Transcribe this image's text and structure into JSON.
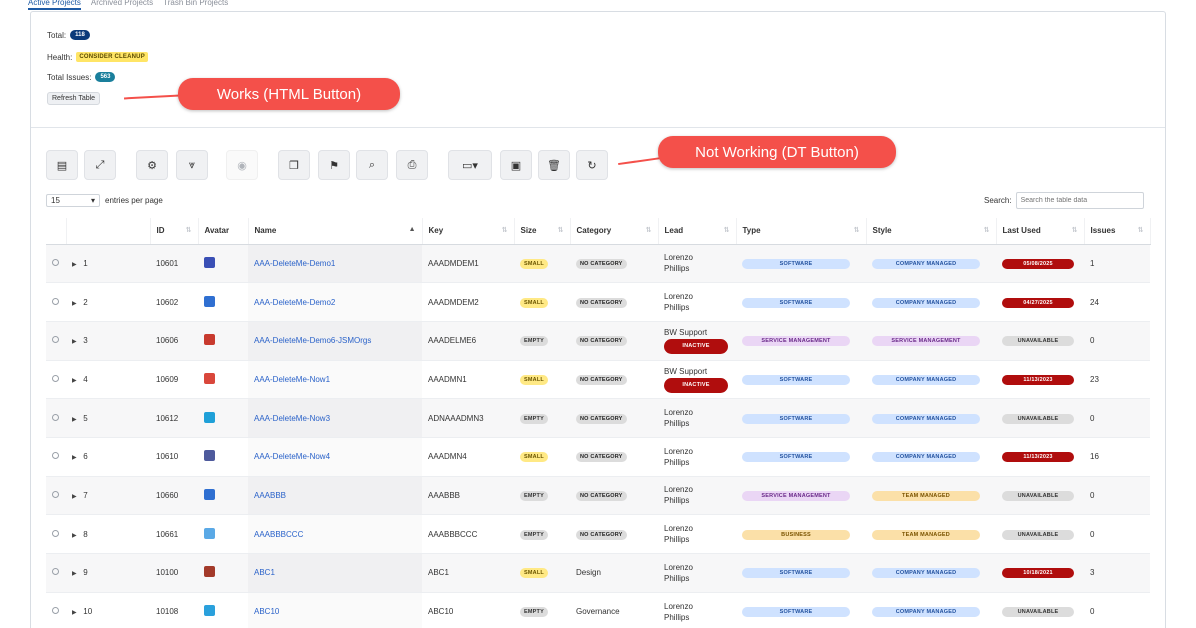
{
  "tabs": [
    "Active Projects",
    "Archived Projects",
    "Trash Bin Projects"
  ],
  "summary": {
    "total_label": "Total:",
    "total_value": "118",
    "health_label": "Health:",
    "health_value": "CONSIDER CLEANUP",
    "issues_label": "Total Issues:",
    "issues_value": "563",
    "refresh_label": "Refresh Table"
  },
  "callouts": {
    "works": "Works (HTML Button)",
    "not_working": "Not Working (DT Button)"
  },
  "toolbar": {
    "buttons": [
      "select-all-icon",
      "expand-icon",
      "settings-icon",
      "collapse-icon",
      "eye-icon",
      "copy-icon",
      "bookmark-icon",
      "search-doc-icon",
      "print-icon",
      "columns-icon",
      "save-icon",
      "trash-icon",
      "refresh-icon"
    ]
  },
  "entries": {
    "value": "15",
    "suffix": "entries per page"
  },
  "search": {
    "label": "Search:",
    "placeholder": "Search the table data"
  },
  "columns": [
    "",
    "",
    "ID",
    "Avatar",
    "Name",
    "Key",
    "Size",
    "Category",
    "Lead",
    "Type",
    "Style",
    "Last Used",
    "Issues"
  ],
  "rows": [
    {
      "num": "1",
      "id": "10601",
      "avatar_color": "#3a4fb5",
      "name": "AAA-DeleteMe-Demo1",
      "key": "AAADMDEM1",
      "size": "SMALL",
      "category": "NO CATEGORY",
      "lead": [
        "Lorenzo",
        "Phillips"
      ],
      "inactive": "",
      "type": "SOFTWARE",
      "style": "COMPANY MANAGED",
      "last_used": "05/08/2025",
      "issues": "1"
    },
    {
      "num": "2",
      "id": "10602",
      "avatar_color": "#2f6fd1",
      "name": "AAA-DeleteMe-Demo2",
      "key": "AAADMDEM2",
      "size": "SMALL",
      "category": "NO CATEGORY",
      "lead": [
        "Lorenzo",
        "Phillips"
      ],
      "inactive": "",
      "type": "SOFTWARE",
      "style": "COMPANY MANAGED",
      "last_used": "04/27/2025",
      "issues": "24"
    },
    {
      "num": "3",
      "id": "10606",
      "avatar_color": "#c83a2e",
      "name": "AAA-DeleteMe-Demo6-JSMOrgs",
      "key": "AAADELME6",
      "size": "EMPTY",
      "category": "NO CATEGORY",
      "lead": [
        "BW Support",
        ""
      ],
      "inactive": "INACTIVE",
      "type": "SERVICE MANAGEMENT",
      "style": "SERVICE MANAGEMENT",
      "last_used": "UNAVAILABLE",
      "issues": "0"
    },
    {
      "num": "4",
      "id": "10609",
      "avatar_color": "#d9473b",
      "name": "AAA-DeleteMe-Now1",
      "key": "AAADMN1",
      "size": "SMALL",
      "category": "NO CATEGORY",
      "lead": [
        "BW Support",
        ""
      ],
      "inactive": "INACTIVE",
      "type": "SOFTWARE",
      "style": "COMPANY MANAGED",
      "last_used": "11/13/2023",
      "issues": "23"
    },
    {
      "num": "5",
      "id": "10612",
      "avatar_color": "#1fa0d8",
      "name": "AAA-DeleteMe-Now3",
      "key": "ADNAAADMN3",
      "size": "EMPTY",
      "category": "NO CATEGORY",
      "lead": [
        "Lorenzo",
        "Phillips"
      ],
      "inactive": "",
      "type": "SOFTWARE",
      "style": "COMPANY MANAGED",
      "last_used": "UNAVAILABLE",
      "issues": "0"
    },
    {
      "num": "6",
      "id": "10610",
      "avatar_color": "#4e5a9c",
      "name": "AAA-DeleteMe-Now4",
      "key": "AAADMN4",
      "size": "SMALL",
      "category": "NO CATEGORY",
      "lead": [
        "Lorenzo",
        "Phillips"
      ],
      "inactive": "",
      "type": "SOFTWARE",
      "style": "COMPANY MANAGED",
      "last_used": "11/13/2023",
      "issues": "16"
    },
    {
      "num": "7",
      "id": "10660",
      "avatar_color": "#2f6fd1",
      "name": "AAABBB",
      "key": "AAABBB",
      "size": "EMPTY",
      "category": "NO CATEGORY",
      "lead": [
        "Lorenzo",
        "Phillips"
      ],
      "inactive": "",
      "type": "SERVICE MANAGEMENT",
      "style": "TEAM MANAGED",
      "last_used": "UNAVAILABLE",
      "issues": "0"
    },
    {
      "num": "8",
      "id": "10661",
      "avatar_color": "#5aa9e6",
      "name": "AAABBBCCC",
      "key": "AAABBBCCC",
      "size": "EMPTY",
      "category": "NO CATEGORY",
      "lead": [
        "Lorenzo",
        "Phillips"
      ],
      "inactive": "",
      "type": "BUSINESS",
      "style": "TEAM MANAGED",
      "last_used": "UNAVAILABLE",
      "issues": "0"
    },
    {
      "num": "9",
      "id": "10100",
      "avatar_color": "#a33a2a",
      "name": "ABC1",
      "key": "ABC1",
      "size": "SMALL",
      "category": "Design",
      "lead": [
        "Lorenzo",
        "Phillips"
      ],
      "inactive": "",
      "type": "SOFTWARE",
      "style": "COMPANY MANAGED",
      "last_used": "10/18/2021",
      "issues": "3"
    },
    {
      "num": "10",
      "id": "10108",
      "avatar_color": "#2aa0dc",
      "name": "ABC10",
      "key": "ABC10",
      "size": "EMPTY",
      "category": "Governance",
      "lead": [
        "Lorenzo",
        "Phillips"
      ],
      "inactive": "",
      "type": "SOFTWARE",
      "style": "COMPANY MANAGED",
      "last_used": "UNAVAILABLE",
      "issues": "0"
    }
  ]
}
